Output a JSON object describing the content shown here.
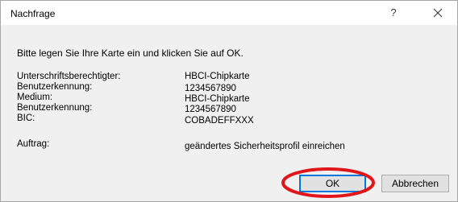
{
  "dialog": {
    "title": "Nachfrage",
    "help_label": "?",
    "close_icon": "close-icon",
    "prompt": "Bitte legen Sie Ihre Karte ein und klicken Sie auf OK.",
    "fields": [
      {
        "label": "Unterschriftsberechtigter:",
        "value": "HBCI-Chipkarte"
      },
      {
        "label": "Benutzerkennung:",
        "value": "1234567890"
      },
      {
        "label": "Medium:",
        "value": "HBCI-Chipkarte"
      },
      {
        "label": "Benutzerkennung:",
        "value": "1234567890"
      },
      {
        "label": "BIC:",
        "value": "COBADEFFXXX"
      }
    ],
    "order_label": "Auftrag:",
    "order_value": "geändertes Sicherheitsprofil einreichen",
    "ok_label": "OK",
    "cancel_label": "Abbrechen",
    "highlight_color": "#e0161a",
    "focus_color": "#0078d7"
  }
}
